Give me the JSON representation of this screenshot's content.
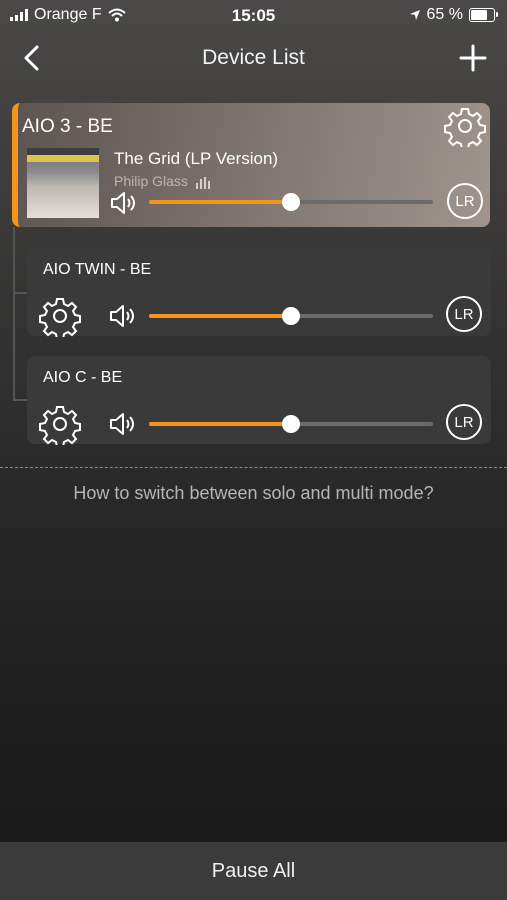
{
  "status_bar": {
    "carrier": "Orange F",
    "time": "15:05",
    "battery": "65 %",
    "battery_level": 0.65
  },
  "nav": {
    "title": "Device List",
    "back_icon": "chevron-left-icon",
    "add_icon": "plus-icon"
  },
  "devices": [
    {
      "name": "AIO 3 - BE",
      "track": "The Grid (LP Version)",
      "artist": "Philip Glass",
      "volume": 0.5,
      "channel": "LR"
    },
    {
      "name": "AIO TWIN - BE",
      "volume": 0.5,
      "channel": "LR"
    },
    {
      "name": "AIO C - BE",
      "volume": 0.5,
      "channel": "LR"
    }
  ],
  "help_text": "How to switch between solo and multi mode?",
  "bottom": {
    "pause_all": "Pause All"
  },
  "colors": {
    "accent": "#f39519",
    "bottom_bar": "#3b3b3b",
    "card": "#3a3a3a"
  }
}
